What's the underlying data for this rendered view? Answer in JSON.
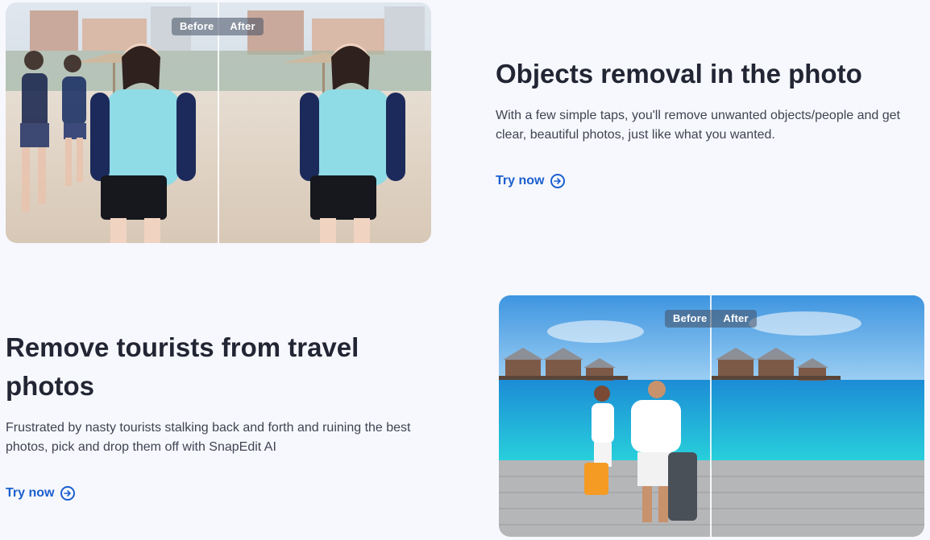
{
  "sections": [
    {
      "title": "Objects removal in the photo",
      "description": "With a few simple taps, you'll remove unwanted objects/people and get clear, beautiful photos, just like what you wanted.",
      "cta": "Try now",
      "before_label": "Before",
      "after_label": "After"
    },
    {
      "title": "Remove tourists from travel photos",
      "description": "Frustrated by nasty tourists stalking back and forth and ruining the best photos, pick and drop them off with SnapEdit AI",
      "cta": "Try now",
      "before_label": "Before",
      "after_label": "After"
    }
  ],
  "icons": {
    "cta": "arrow-right-circle-icon"
  },
  "colors": {
    "accent": "#1b5fcf",
    "background": "#f7f8fd",
    "heading": "#222533"
  }
}
